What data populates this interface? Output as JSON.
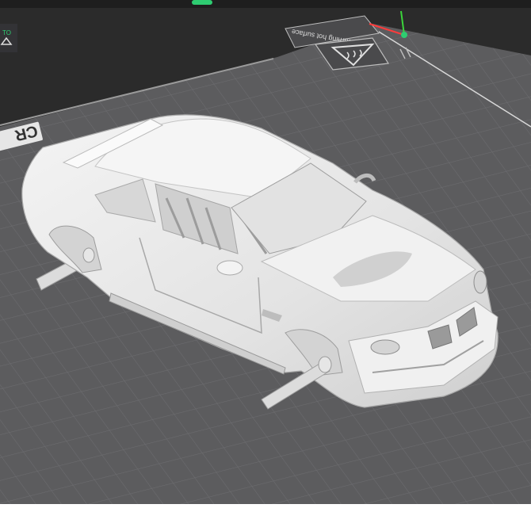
{
  "viewport": {
    "bed_brand_text": "CR",
    "warning_text": "Warning hot surface",
    "partial_label": "TO"
  },
  "model": {
    "name": "car-body"
  },
  "colors": {
    "background": "#2b2b2b",
    "bed": "#5c5c5e",
    "grid_line": "#6c6c6f",
    "model": "#e9e9e9",
    "model_shadow": "#bcbcbc",
    "axis_x": "#ff3b3b",
    "axis_y": "#3bd43b",
    "accent_green": "#2ecc71"
  }
}
